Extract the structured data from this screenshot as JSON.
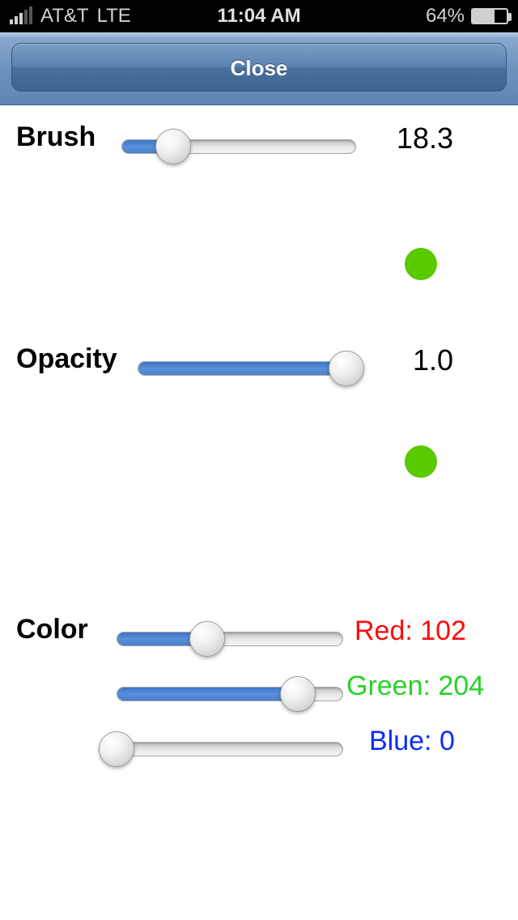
{
  "status": {
    "carrier": "AT&T",
    "network": "LTE",
    "time": "11:04 AM",
    "battery_pct": "64%"
  },
  "nav": {
    "close_label": "Close"
  },
  "brush": {
    "label": "Brush",
    "value": "18.3",
    "fill_pct": 22
  },
  "opacity": {
    "label": "Opacity",
    "value": "1.0",
    "fill_pct": 100
  },
  "preview": {
    "color_hex": "#59c900"
  },
  "color": {
    "label": "Color",
    "red": {
      "label": "Red: 102",
      "value": 102,
      "fill_pct": 40
    },
    "green": {
      "label": "Green: 204",
      "value": 204,
      "fill_pct": 80
    },
    "blue": {
      "label": "Blue: 0",
      "value": 0,
      "fill_pct": 0
    }
  }
}
